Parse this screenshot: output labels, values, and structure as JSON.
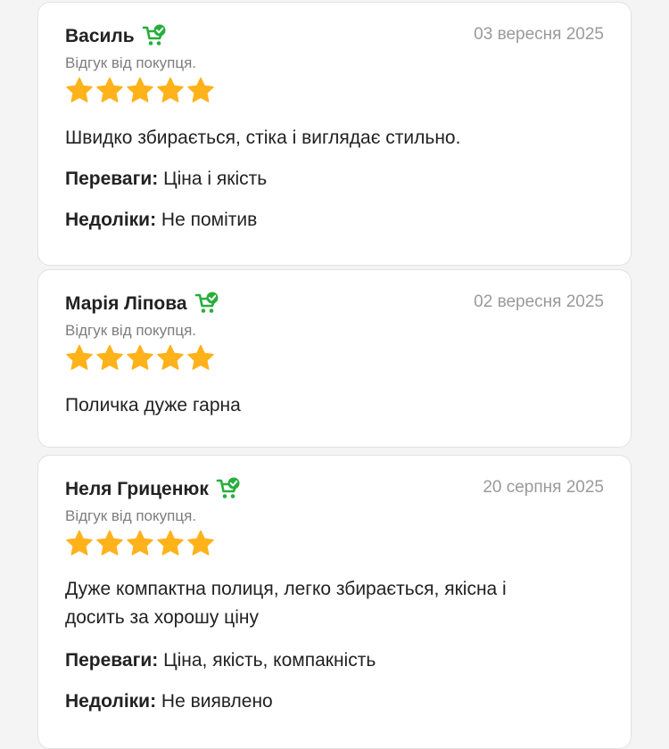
{
  "colors": {
    "accent_green": "#27ae3c",
    "star": "#ffb21a",
    "date_gray": "#9a9a9c"
  },
  "icons": {
    "verified": "shopping-cart-check-icon",
    "rating": "star-icon"
  },
  "reviews": [
    {
      "author": "Василь",
      "date": "03 вересня 2025",
      "subtitle": "Відгук від покупця.",
      "rating": 5,
      "text": "Швидко збирається, стіка і виглядає стильно.",
      "pros_label": "Переваги:",
      "pros": " Ціна і якість",
      "cons_label": "Недоліки:",
      "cons": " Не помітив"
    },
    {
      "author": "Марія Ліпова",
      "date": "02 вересня 2025",
      "subtitle": "Відгук від покупця.",
      "rating": 5,
      "text": "Поличка дуже гарна"
    },
    {
      "author": "Неля Гриценюк",
      "date": "20 серпня 2025",
      "subtitle": "Відгук від покупця.",
      "rating": 5,
      "text_line1": "Дуже компактна полиця, легко збирається, якісна і",
      "text_line2": "досить за хорошу ціну",
      "pros_label": "Переваги:",
      "pros": " Ціна, якість, компакність",
      "cons_label": "Недоліки:",
      "cons": " Не виявлено"
    }
  ]
}
